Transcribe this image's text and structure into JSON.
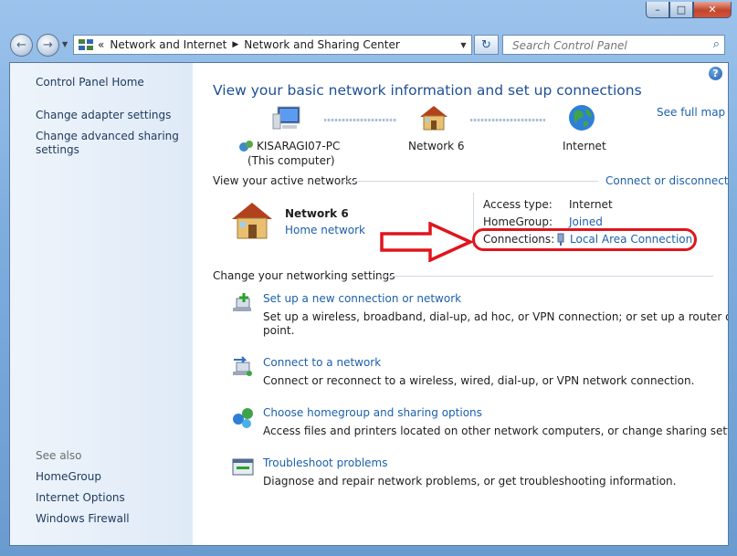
{
  "window": {
    "caption_buttons": [
      "minimize-icon",
      "maximize-icon",
      "close-icon"
    ]
  },
  "nav": {
    "back_icon": "back-arrow-icon",
    "forward_icon": "forward-arrow-icon",
    "breadcrumb_prefix": "«",
    "breadcrumbs": [
      "Network and Internet",
      "Network and Sharing Center"
    ],
    "search_placeholder": "Search Control Panel"
  },
  "sidebar": {
    "home": "Control Panel Home",
    "links": [
      "Change adapter settings",
      "Change advanced sharing settings"
    ],
    "see_also_label": "See also",
    "see_also": [
      "HomeGroup",
      "Internet Options",
      "Windows Firewall"
    ]
  },
  "main": {
    "title": "View your basic network information and set up connections",
    "see_full_map": "See full map",
    "map": {
      "computer_name": "KISARAGI07-PC",
      "computer_sub": "(This computer)",
      "network_name": "Network  6",
      "internet": "Internet"
    },
    "active_networks_label": "View your active networks",
    "connect_or_disconnect": "Connect or disconnect",
    "active": {
      "name": "Network  6",
      "type": "Home network",
      "access_type_label": "Access type:",
      "access_type_value": "Internet",
      "homegroup_label": "HomeGroup:",
      "homegroup_value": "Joined",
      "connections_label": "Connections:",
      "connections_value": "Local Area Connection"
    },
    "change_settings_label": "Change your networking settings",
    "tasks": [
      {
        "title": "Set up a new connection or network",
        "desc1": "Set up a wireless, broadband, dial-up, ad hoc, or VPN connection; or set up a router or access",
        "desc2": "point."
      },
      {
        "title": "Connect to a network",
        "desc1": "Connect or reconnect to a wireless, wired, dial-up, or VPN network connection."
      },
      {
        "title": "Choose homegroup and sharing options",
        "desc1": "Access files and printers located on other network computers, or change sharing settings."
      },
      {
        "title": "Troubleshoot problems",
        "desc1": "Diagnose and repair network problems, or get troubleshooting information."
      }
    ]
  },
  "annotation": {
    "arrow_color": "#e1141c",
    "highlight_color": "#e1141c"
  }
}
